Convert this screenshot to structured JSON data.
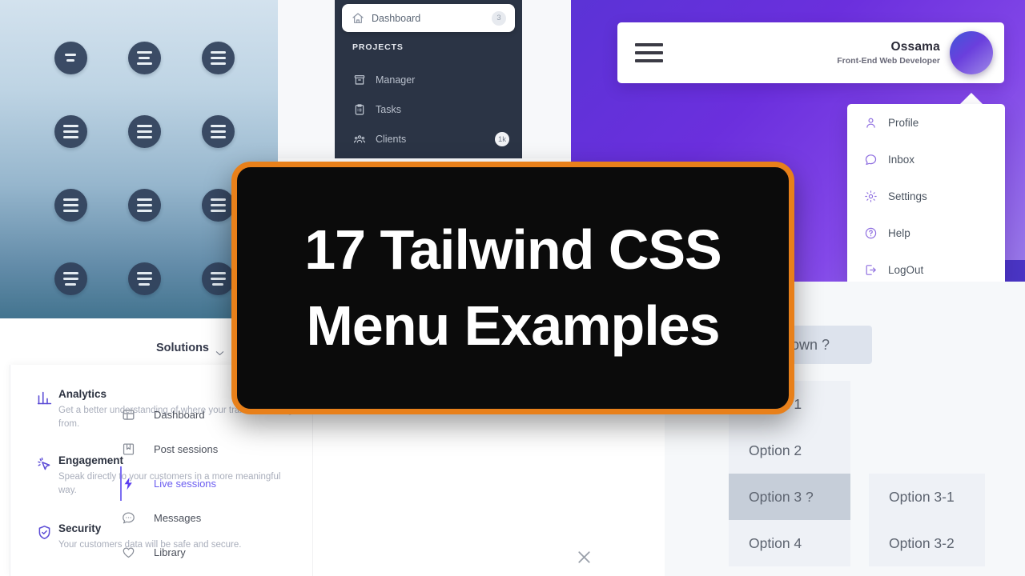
{
  "banner": {
    "line1": "17 Tailwind CSS",
    "line2": "Menu Examples",
    "border_color": "#e8801a",
    "background_color": "#0b0b0b"
  },
  "hamburger_panel": {
    "name": "circular-hamburger-button-grid",
    "rows": 4,
    "columns": 3,
    "gradient_from": "#d3e2ee",
    "gradient_to": "#43748f",
    "button_color": "#30405a"
  },
  "sidebar": {
    "background_color": "#2b3445",
    "active_item": {
      "label": "Dashboard",
      "icon": "home-icon",
      "badge": "3"
    },
    "section_title": "PROJECTS",
    "items": [
      {
        "label": "Manager",
        "icon": "archive-box-icon",
        "badge": ""
      },
      {
        "label": "Tasks",
        "icon": "clipboard-icon",
        "badge": ""
      },
      {
        "label": "Clients",
        "icon": "users-group-icon",
        "badge": "1k"
      }
    ]
  },
  "profile": {
    "gradient_from": "#5b33d6",
    "gradient_to": "#9a7ce8",
    "navbar": {
      "menu_icon": "hamburger-icon",
      "user_name": "Ossama",
      "user_role": "Front-End Web Developer",
      "avatar": "user-avatar"
    },
    "dropdown": {
      "accent_color": "#8f6fe0",
      "items": [
        {
          "label": "Profile",
          "icon": "user-icon"
        },
        {
          "label": "Inbox",
          "icon": "chat-bubble-icon"
        },
        {
          "label": "Settings",
          "icon": "gear-icon"
        },
        {
          "label": "Help",
          "icon": "question-circle-icon"
        },
        {
          "label": "LogOut",
          "icon": "logout-icon"
        }
      ]
    }
  },
  "solutions": {
    "trigger_label": "Solutions",
    "trigger_icon": "chevron-down-icon",
    "accent_color": "#5b4bd6",
    "items": [
      {
        "title": "Analytics",
        "icon": "bar-chart-icon",
        "description": "Get a better understanding of where your traffic is coming from."
      },
      {
        "title": "Engagement",
        "icon": "cursor-click-icon",
        "description": "Speak directly to your customers in a more meaningful way."
      },
      {
        "title": "Security",
        "icon": "shield-check-icon",
        "description": "Your customers data will be safe and secure."
      }
    ]
  },
  "sessions": {
    "active_color": "#6a5cf0",
    "close_icon": "close-icon",
    "items": [
      {
        "label": "Dashboard",
        "icon": "grid-icon",
        "active": false
      },
      {
        "label": "Post sessions",
        "icon": "bookmark-icon",
        "active": false
      },
      {
        "label": "Live sessions",
        "icon": "lightning-bolt-icon",
        "active": true
      },
      {
        "label": "Messages",
        "icon": "chat-dots-icon",
        "active": false
      },
      {
        "label": "Library",
        "icon": "heart-icon",
        "active": false
      }
    ]
  },
  "options": {
    "trigger_label": "Dropdown ?",
    "trigger_background": "#dde3ed",
    "list_background": "#eef1f6",
    "selected_background": "#c6ced9",
    "items": [
      {
        "label": "Option 1",
        "selected": false
      },
      {
        "label": "Option 2",
        "selected": false
      },
      {
        "label": "Option 3 ?",
        "selected": true
      },
      {
        "label": "Option 4",
        "selected": false
      }
    ],
    "submenu": [
      {
        "label": "Option 3-1"
      },
      {
        "label": "Option 3-2"
      }
    ]
  }
}
